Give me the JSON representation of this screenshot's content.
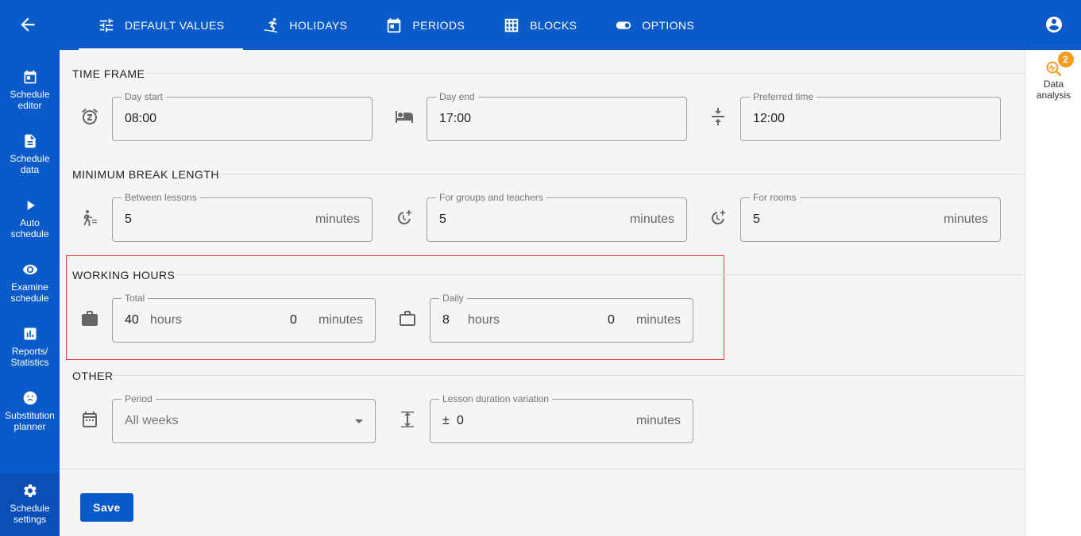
{
  "header": {
    "tabs": [
      {
        "label": "DEFAULT VALUES",
        "icon": "sliders-icon"
      },
      {
        "label": "HOLIDAYS",
        "icon": "skiing-icon"
      },
      {
        "label": "PERIODS",
        "icon": "calendar-icon"
      },
      {
        "label": "BLOCKS",
        "icon": "grid-icon"
      },
      {
        "label": "OPTIONS",
        "icon": "toggle-icon"
      }
    ]
  },
  "sidebar": {
    "items": [
      {
        "label": "Schedule editor",
        "icon": "calendar-icon"
      },
      {
        "label": "Schedule data",
        "icon": "document-icon"
      },
      {
        "label": "Auto schedule",
        "icon": "play-icon"
      },
      {
        "label": "Examine schedule",
        "icon": "eye-icon"
      },
      {
        "label": "Reports/ Statistics",
        "icon": "chart-icon"
      },
      {
        "label": "Substitution planner",
        "icon": "sick-face-icon"
      },
      {
        "label": "Schedule settings",
        "icon": "gear-icon"
      }
    ]
  },
  "right_panel": {
    "label": "Data analysis",
    "badge": "2"
  },
  "sections": {
    "time_frame": {
      "title": "TIME FRAME",
      "day_start": {
        "label": "Day start",
        "value": "08:00"
      },
      "day_end": {
        "label": "Day end",
        "value": "17:00"
      },
      "preferred_time": {
        "label": "Preferred time",
        "value": "12:00"
      }
    },
    "min_break": {
      "title": "MINIMUM BREAK LENGTH",
      "between_lessons": {
        "label": "Between lessons",
        "value": "5",
        "suffix": "minutes"
      },
      "groups_teachers": {
        "label": "For groups and teachers",
        "value": "5",
        "suffix": "minutes"
      },
      "rooms": {
        "label": "For rooms",
        "value": "5",
        "suffix": "minutes"
      }
    },
    "working_hours": {
      "title": "WORKING HOURS",
      "total": {
        "label": "Total",
        "hours": "40",
        "hours_unit": "hours",
        "minutes": "0",
        "minutes_unit": "minutes"
      },
      "daily": {
        "label": "Daily",
        "hours": "8",
        "hours_unit": "hours",
        "minutes": "0",
        "minutes_unit": "minutes"
      }
    },
    "other": {
      "title": "OTHER",
      "period": {
        "label": "Period",
        "value": "All weeks"
      },
      "lesson_variation": {
        "label": "Lesson duration variation",
        "prefix": "±",
        "value": "0",
        "suffix": "minutes"
      }
    }
  },
  "actions": {
    "save_label": "Save"
  },
  "colors": {
    "primary": "#0a5ac9",
    "badge": "#f59c1a",
    "highlight": "#e53935"
  }
}
